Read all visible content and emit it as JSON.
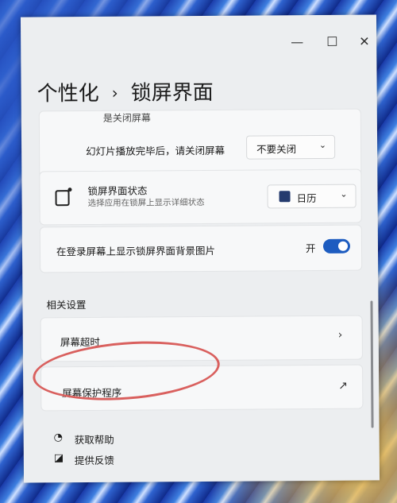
{
  "window": {
    "minimize": "—",
    "maximize": "☐",
    "close": "✕"
  },
  "breadcrumb": {
    "parent": "个性化",
    "separator": "›",
    "current": "锁屏界面"
  },
  "partial_row": {
    "label": "是关闭屏幕"
  },
  "slideshow_row": {
    "label": "幻灯片播放完毕后，请关闭屏幕",
    "dropdown_value": "不要关闭",
    "chevron": "⌄"
  },
  "lock_status_row": {
    "label": "锁屏界面状态",
    "description": "选择应用在锁屏上显示详细状态",
    "dropdown_value": "日历",
    "chevron": "⌄"
  },
  "signin_bg_row": {
    "label": "在登录屏幕上显示锁屏界面背景图片",
    "toggle_label": "开",
    "toggle_on": true,
    "accent": "#1d5cc0"
  },
  "related": {
    "heading": "相关设置",
    "items": [
      {
        "label": "屏幕超时",
        "icon": "chevron-right-icon",
        "glyph": "›"
      },
      {
        "label": "屏幕保护程序",
        "icon": "external-link-icon",
        "glyph": "↗"
      }
    ]
  },
  "footer_links": [
    {
      "label": "获取帮助",
      "icon": "help-icon"
    },
    {
      "label": "提供反馈",
      "icon": "feedback-icon"
    }
  ],
  "annotation_color": "#d9605e"
}
